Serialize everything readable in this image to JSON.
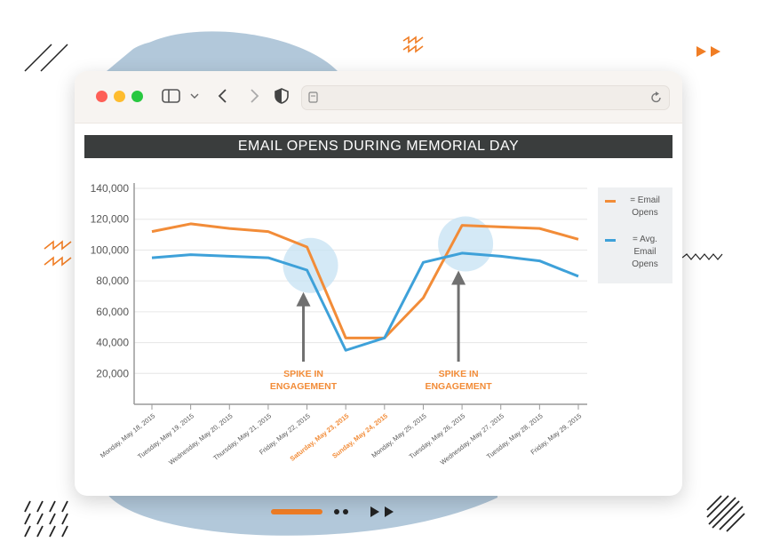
{
  "chart_data": {
    "type": "line",
    "title": "EMAIL OPENS DURING MEMORIAL DAY",
    "categories": [
      "Monday, May 18, 2015",
      "Tuesday, May 19, 2015",
      "Wednesday, May 20, 2015",
      "Thursday, May 21, 2015",
      "Friday, May 22, 2015",
      "Saturday, May 23, 2015",
      "Sunday, May 24, 2015",
      "Monday, May 25, 2015",
      "Tuesday, May 26, 2015",
      "Wednesday, May 27, 2015",
      "Tuesday, May 28, 2015",
      "Friday, May 29, 2015"
    ],
    "highlighted_categories": [
      "Saturday, May 23, 2015",
      "Sunday, May 24, 2015"
    ],
    "series": [
      {
        "name": "= Email Opens",
        "color": "#f28c38",
        "values": [
          112000,
          117000,
          114000,
          112000,
          102000,
          43000,
          43000,
          69000,
          116000,
          115000,
          114000,
          107000
        ]
      },
      {
        "name": "= Avg. Email Opens",
        "color": "#3ea1d9",
        "values": [
          95000,
          97000,
          96000,
          95000,
          87000,
          35000,
          43000,
          92000,
          98000,
          96000,
          93000,
          83000
        ]
      }
    ],
    "ylim": [
      0,
      140000
    ],
    "yticks": [
      140000,
      120000,
      100000,
      80000,
      60000,
      40000,
      20000
    ],
    "ytick_labels": [
      "140,000",
      "120,000",
      "100,000",
      "80,000",
      "60,000",
      "40,000",
      "20,000"
    ],
    "grid": true,
    "legend_position": "right",
    "annotations": [
      {
        "text": [
          "SPIKE IN",
          "ENGAGEMENT"
        ],
        "category_index": 4,
        "value": 90000
      },
      {
        "text": [
          "SPIKE IN",
          "ENGAGEMENT"
        ],
        "category_index": 8,
        "value": 104000
      }
    ],
    "colors": {
      "annotation_text": "#f28c38",
      "highlight_circle": "#c6e2f3",
      "arrow": "#707070",
      "axis": "#9a9a9a",
      "grid": "#e6e6e6",
      "tick_text": "#555555"
    }
  },
  "legend": {
    "email_opens": [
      "= Email",
      "Opens"
    ],
    "avg_email_opens": [
      "= Avg.",
      "Email",
      "Opens"
    ]
  },
  "browser": {
    "traffic_lights": [
      "#fe5f57",
      "#febc2e",
      "#28c840"
    ]
  },
  "decor": {
    "accent": "#f07d24",
    "blob": "#b2c8da",
    "ink": "#222222"
  }
}
